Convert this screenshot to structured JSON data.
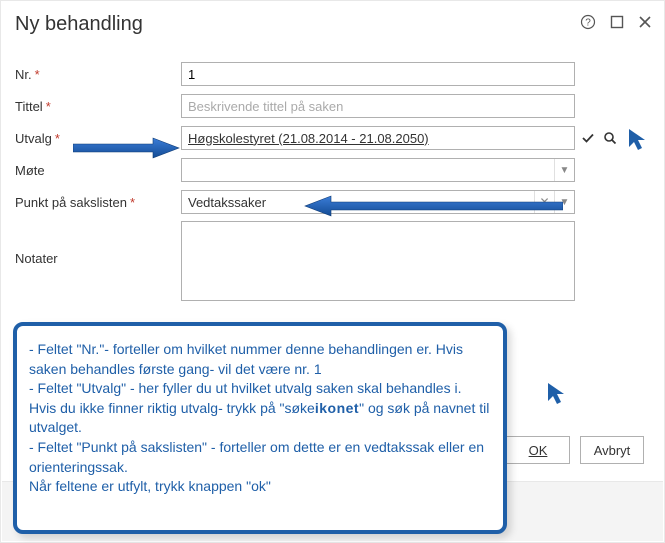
{
  "window": {
    "title": "Ny behandling"
  },
  "form": {
    "nr": {
      "label": "Nr.",
      "value": "1"
    },
    "tittel": {
      "label": "Tittel",
      "placeholder": "Beskrivende tittel på saken",
      "value": ""
    },
    "utvalg": {
      "label": "Utvalg",
      "value": "Høgskolestyret (21.08.2014 - 21.08.2050)"
    },
    "mote": {
      "label": "Møte",
      "value": ""
    },
    "punkt": {
      "label": "Punkt på sakslisten",
      "value": "Vedtakssaker"
    },
    "notater": {
      "label": "Notater",
      "value": ""
    }
  },
  "buttons": {
    "ok": "OK",
    "cancel": "Avbryt"
  },
  "annotation": {
    "line1": "- Feltet \"Nr.\"- forteller om hvilket nummer denne behandlingen er. Hvis saken behandles første gang- vil det være nr. 1",
    "line2": "- Feltet \"Utvalg\" - her fyller du ut hvilket utvalg saken skal behandles i. Hvis du ikke finner riktig utvalg- trykk på \"søke",
    "ikon_word": "ikonet",
    "line2b": "\" og søk på navnet til utvalget.",
    "line3": "- Feltet \"Punkt på sakslisten\" - forteller om dette er en vedtakssak eller en orienteringssak.",
    "line4": "Når feltene er utfylt, trykk knappen \"ok\""
  }
}
